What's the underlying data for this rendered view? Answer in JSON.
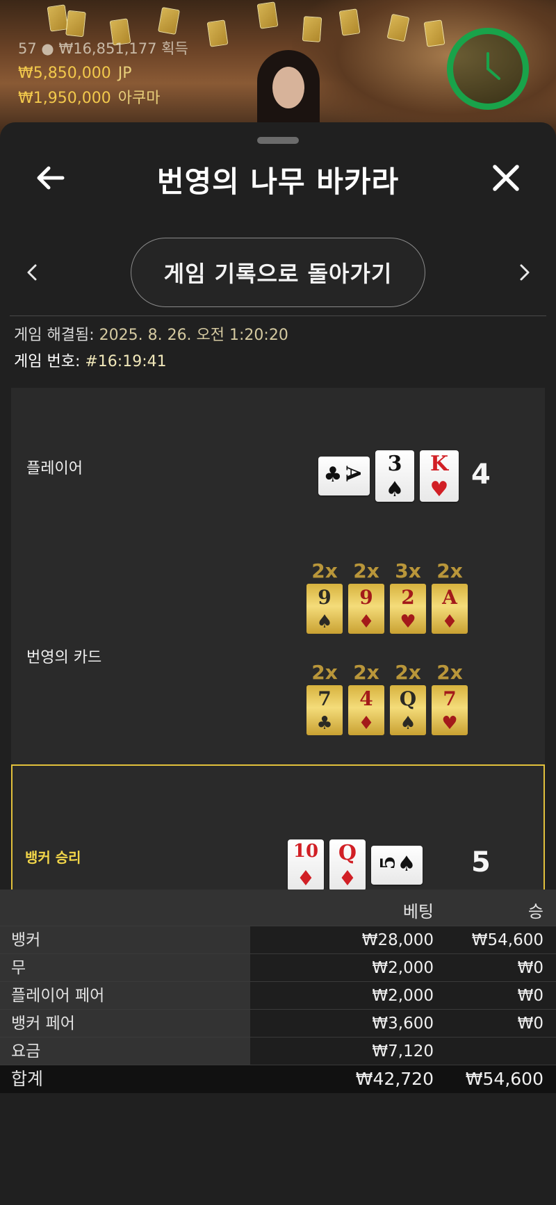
{
  "stream": {
    "players_count": "57",
    "total_amount": "₩16,85",
    "total_amount_hidden": "1,177",
    "total_suffix": "획득",
    "jackpots": [
      {
        "amount": "₩5,850,000",
        "label": "JP"
      },
      {
        "amount": "₩1,950,000",
        "label": "아쿠마"
      }
    ]
  },
  "header": {
    "title": "번영의 나무 바카라"
  },
  "nav": {
    "return_label": "게임 기록으로 돌아가기"
  },
  "meta": {
    "resolved_label": "게임 해결됨:",
    "resolved_value": "2025. 8. 26. 오전 1:20:20",
    "game_no_label": "게임 번호:",
    "game_no_value": "#16:19:41"
  },
  "result": {
    "player": {
      "label": "플레이어",
      "score": "4",
      "cards": [
        {
          "rank": "A",
          "suit": "♣",
          "color": "black",
          "orientation": "sideways"
        },
        {
          "rank": "3",
          "suit": "♠",
          "color": "black",
          "orientation": "upright"
        },
        {
          "rank": "K",
          "suit": "♥",
          "color": "red",
          "orientation": "upright"
        }
      ]
    },
    "prosperity": {
      "label": "번영의 카드",
      "rows": [
        [
          {
            "mult": "2x",
            "rank": "9",
            "suit": "♠",
            "color": "black"
          },
          {
            "mult": "2x",
            "rank": "9",
            "suit": "♦",
            "color": "red"
          },
          {
            "mult": "3x",
            "rank": "2",
            "suit": "♥",
            "color": "red"
          },
          {
            "mult": "2x",
            "rank": "A",
            "suit": "♦",
            "color": "red"
          }
        ],
        [
          {
            "mult": "2x",
            "rank": "7",
            "suit": "♣",
            "color": "black"
          },
          {
            "mult": "2x",
            "rank": "4",
            "suit": "♦",
            "color": "red"
          },
          {
            "mult": "2x",
            "rank": "Q",
            "suit": "♠",
            "color": "black"
          },
          {
            "mult": "2x",
            "rank": "7",
            "suit": "♥",
            "color": "red"
          }
        ]
      ]
    },
    "banker": {
      "label": "뱅커 승리",
      "score": "5",
      "cards": [
        {
          "rank": "10",
          "suit": "♦",
          "color": "red",
          "orientation": "upright"
        },
        {
          "rank": "Q",
          "suit": "♦",
          "color": "red",
          "orientation": "upright"
        },
        {
          "rank": "5",
          "suit": "♠",
          "color": "black",
          "orientation": "sideways"
        }
      ]
    }
  },
  "bets": {
    "col_bet": "베팅",
    "col_win": "승",
    "rows": [
      {
        "name": "뱅커",
        "bet": "₩28,000",
        "win": "₩54,600"
      },
      {
        "name": "무",
        "bet": "₩2,000",
        "win": "₩0"
      },
      {
        "name": "플레이어 페어",
        "bet": "₩2,000",
        "win": "₩0"
      },
      {
        "name": "뱅커 페어",
        "bet": "₩3,600",
        "win": "₩0"
      },
      {
        "name": "요금",
        "bet": "₩7,120",
        "win": ""
      }
    ],
    "total": {
      "name": "합계",
      "bet": "₩42,720",
      "win": "₩54,600"
    }
  },
  "colors": {
    "accent_gold": "#e2c13c",
    "timer_green": "#19a34a",
    "card_red": "#d11f25"
  }
}
